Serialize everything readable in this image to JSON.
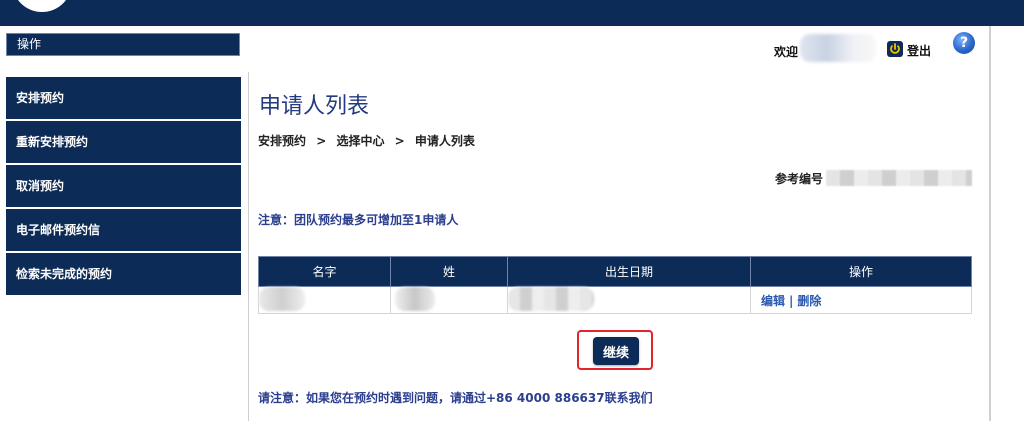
{
  "sidebar": {
    "header": "操作",
    "items": [
      {
        "label": "安排预约"
      },
      {
        "label": "重新安排预约"
      },
      {
        "label": "取消预约"
      },
      {
        "label": "电子邮件预约信"
      },
      {
        "label": "检索未完成的预约"
      }
    ]
  },
  "header": {
    "welcome": "欢迎",
    "logout": "登出",
    "help": "?"
  },
  "main": {
    "title": "申请人列表",
    "breadcrumb": [
      "安排预约",
      "选择中心",
      "申请人列表"
    ],
    "breadcrumb_sep": ">",
    "reference_label": "参考编号",
    "notice": "注意：团队预约最多可增加至1申请人",
    "table": {
      "columns": [
        "名字",
        "姓",
        "出生日期",
        "操作"
      ],
      "rows": [
        {
          "edit": "编辑",
          "sep": "|",
          "delete": "删除"
        }
      ]
    },
    "continue_button": "继续",
    "footer_note": "请注意：如果您在预约时遇到问题，请通过+86 4000 886637联系我们"
  },
  "colors": {
    "navy": "#0d2b57",
    "title_blue": "#243a80",
    "link_blue": "#2a5ab0",
    "highlight_red": "#e3242b"
  }
}
